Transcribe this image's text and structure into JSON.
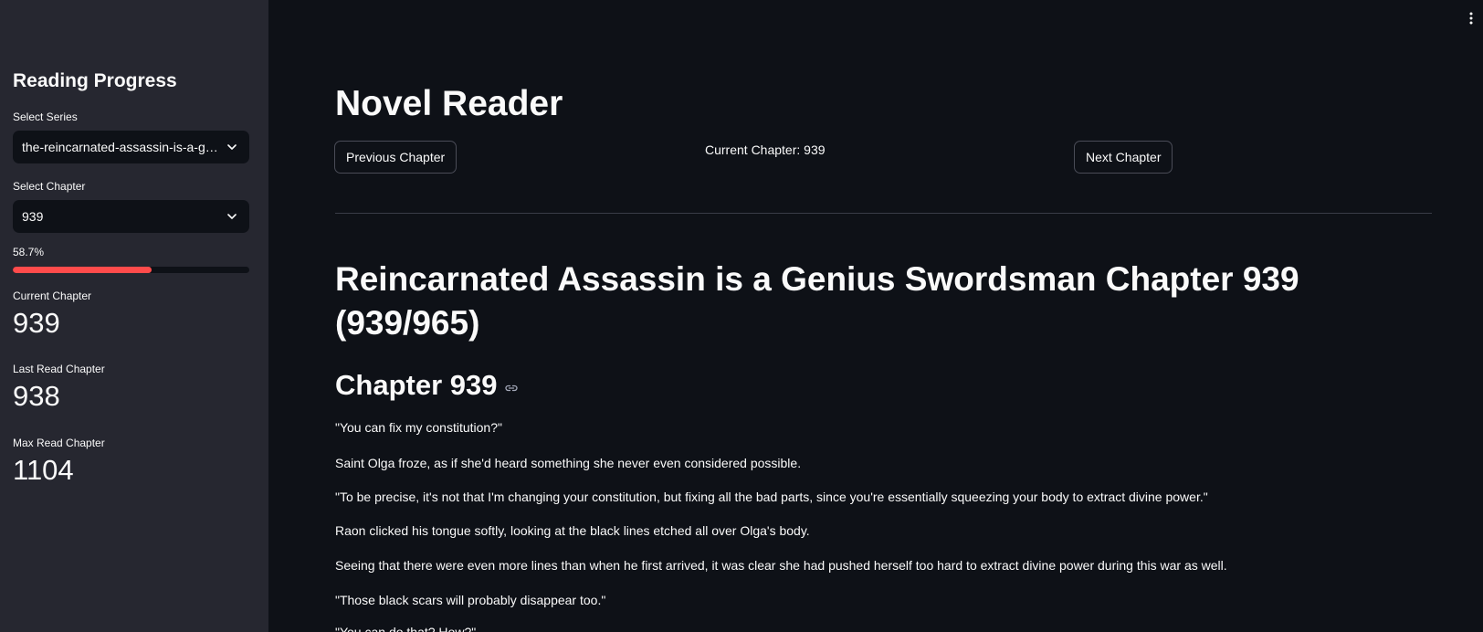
{
  "sidebar": {
    "title": "Reading Progress",
    "series_label": "Select Series",
    "series_value": "the-reincarnated-assassin-is-a-genius-swordsman",
    "chapter_label": "Select Chapter",
    "chapter_value": "939",
    "progress_text": "58.7%",
    "progress_fraction": 0.587,
    "accent_color": "#ff4b4b",
    "metrics": [
      {
        "label": "Current Chapter",
        "value": "939"
      },
      {
        "label": "Last Read Chapter",
        "value": "938"
      },
      {
        "label": "Max Read Chapter",
        "value": "1104"
      }
    ]
  },
  "main": {
    "menu_icon": "vertical-dots-icon",
    "title": "Novel Reader",
    "prev_button": "Previous Chapter",
    "current_chapter_text": "Current Chapter: 939",
    "next_button": "Next Chapter",
    "chapter_title": "Reincarnated Assassin is a Genius Swordsman Chapter 939 (939/965)",
    "chapter_heading": "Chapter 939",
    "anchor_icon": "link-icon",
    "paragraphs": [
      "\"You can fix my constitution?\"",
      "Saint Olga froze, as if she'd heard something she never even considered possible.",
      "\"To be precise, it's not that I'm changing your constitution, but fixing all the bad parts, since you're essentially squeezing your body to extract divine power.\"",
      "Raon clicked his tongue softly, looking at the black lines etched all over Olga's body.",
      "Seeing that there were even more lines than when he first arrived, it was clear she had pushed herself too hard to extract divine power during this war as well.",
      "\"Those black scars will probably disappear too.\"",
      "\"You can do that? How?\""
    ]
  }
}
